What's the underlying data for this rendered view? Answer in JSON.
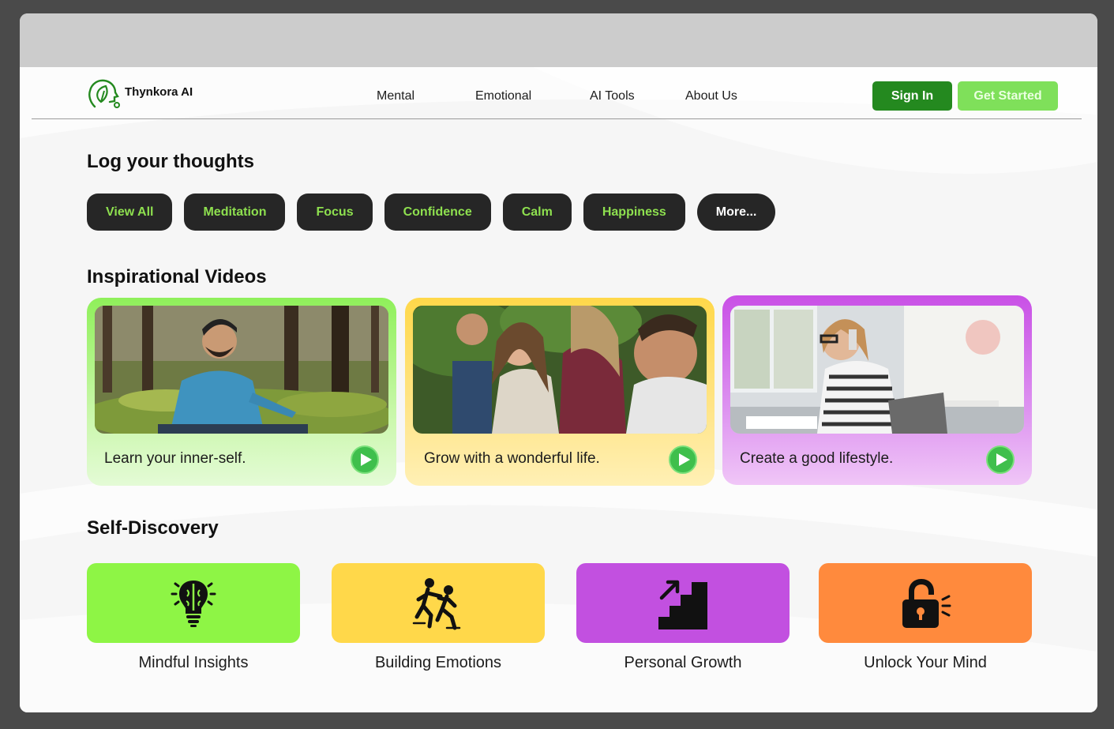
{
  "brand": {
    "name": "Thynkora AI",
    "logo_icon": "head-leaf-icon",
    "color": "#24891f"
  },
  "nav": [
    {
      "label": "Mental"
    },
    {
      "label": "Emotional"
    },
    {
      "label": "AI Tools"
    },
    {
      "label": "About Us"
    }
  ],
  "actions": {
    "sign_in": "Sign In",
    "get_started": "Get Started"
  },
  "thoughts": {
    "title": "Log your thoughts",
    "chips": [
      "View All",
      "Meditation",
      "Focus",
      "Confidence",
      "Calm",
      "Happiness",
      "More..."
    ]
  },
  "videos": {
    "title": "Inspirational Videos",
    "cards": [
      {
        "caption": "Learn your inner-self.",
        "accent": "#8ff05a",
        "image": "man-meditating-in-forest"
      },
      {
        "caption": "Grow with a wonderful life.",
        "accent": "#ffd84a",
        "image": "friends-laughing-outdoors"
      },
      {
        "caption": "Create a good lifestyle.",
        "accent": "#c950e6",
        "image": "woman-on-phone-at-desk"
      }
    ]
  },
  "discovery": {
    "title": "Self-Discovery",
    "items": [
      {
        "label": "Mindful Insights",
        "icon": "brain-bulb-icon",
        "color": "#8ef545"
      },
      {
        "label": "Building Emotions",
        "icon": "helping-hand-icon",
        "color": "#ffd84a"
      },
      {
        "label": "Personal Growth",
        "icon": "stairs-up-icon",
        "color": "#c250e0"
      },
      {
        "label": "Unlock Your Mind",
        "icon": "unlocked-padlock-icon",
        "color": "#ff8a3d"
      }
    ]
  }
}
